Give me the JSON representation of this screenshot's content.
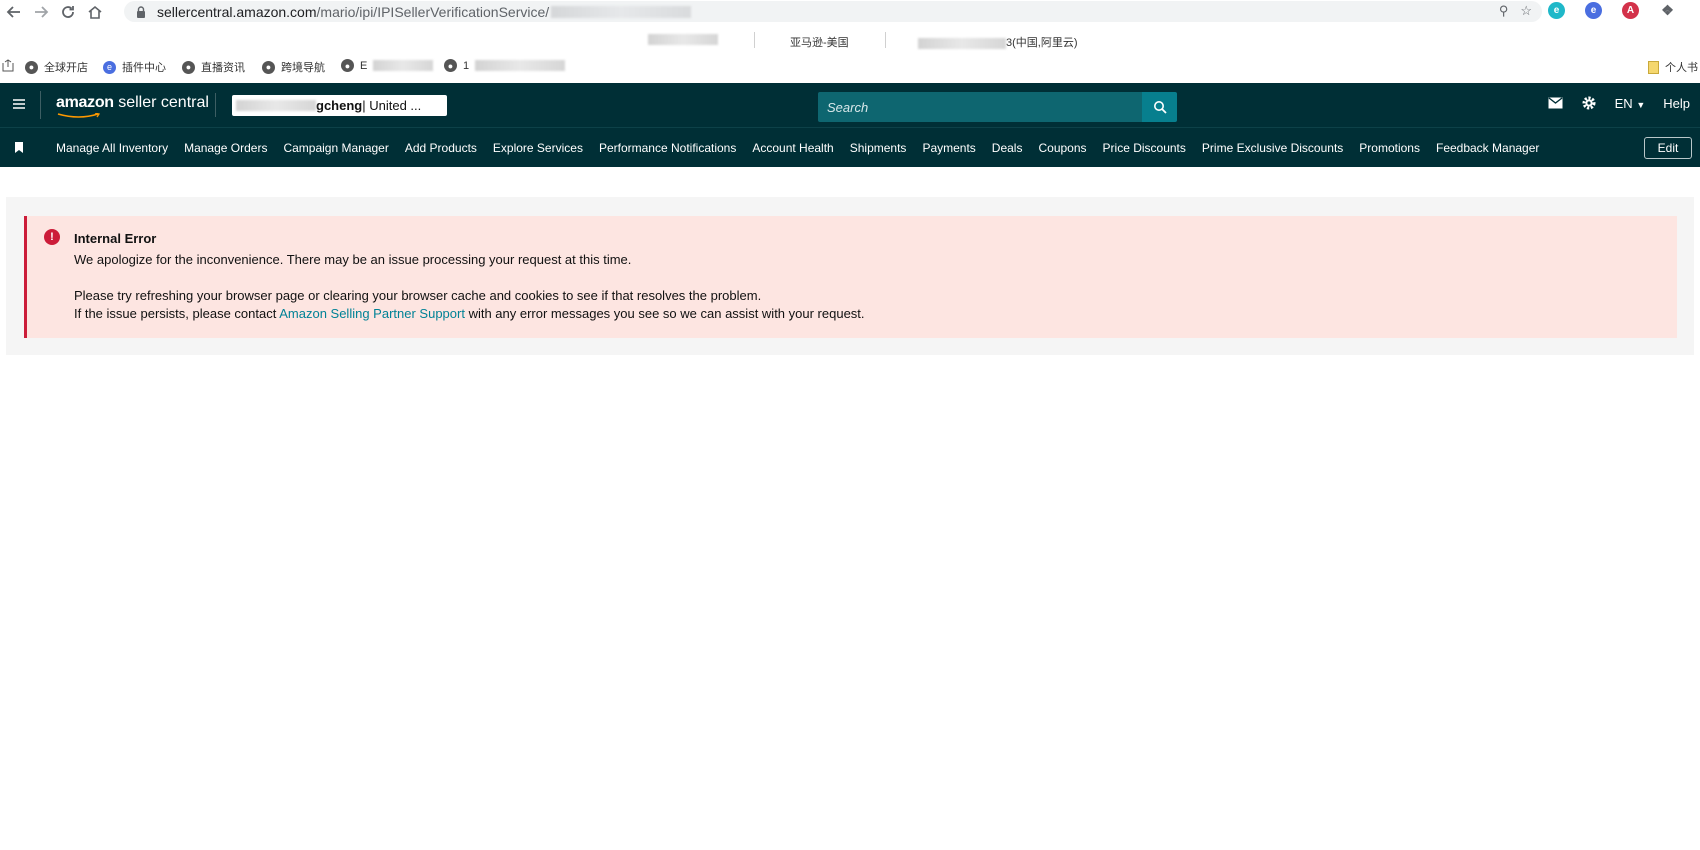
{
  "browser": {
    "url_host": "sellercentral.amazon.com",
    "url_path": "/mario/ipi/IPISellerVerificationService/",
    "tabs": [
      {
        "label": "亚马逊-美国"
      },
      {
        "label": "3(中国,阿里云)"
      }
    ],
    "bookmarks": [
      {
        "label": "全球开店",
        "icon": "globe-icon"
      },
      {
        "label": "插件中心",
        "icon": "plugin-icon"
      },
      {
        "label": "直播资讯",
        "icon": "globe-icon"
      },
      {
        "label": "跨境导航",
        "icon": "globe-icon"
      },
      {
        "label": "E",
        "icon": "globe-icon"
      },
      {
        "label": "1",
        "icon": "globe-icon"
      }
    ],
    "bookmark_folder": "个人书"
  },
  "header": {
    "logo_brand": "amazon",
    "logo_product": " seller central",
    "account_suffix": "gcheng",
    "account_region": " | United ...",
    "search_placeholder": "Search",
    "language": "EN",
    "help": "Help"
  },
  "nav": {
    "items": [
      "Manage All Inventory",
      "Manage Orders",
      "Campaign Manager",
      "Add Products",
      "Explore Services",
      "Performance Notifications",
      "Account Health",
      "Shipments",
      "Payments",
      "Deals",
      "Coupons",
      "Price Discounts",
      "Prime Exclusive Discounts",
      "Promotions",
      "Feedback Manager"
    ],
    "edit": "Edit"
  },
  "alert": {
    "icon": "!",
    "title": "Internal Error",
    "line1": "We apologize for the inconvenience. There may be an issue processing your request at this time.",
    "line2": "Please try refreshing your browser page or clearing your browser cache and cookies to see if that resolves the problem.",
    "line3_pre": "If the issue persists, please contact ",
    "line3_link": "Amazon Selling Partner Support",
    "line3_post": " with any error messages you see so we can assist with your request."
  },
  "colors": {
    "header_bg": "#002f36",
    "search_bg": "#0e6670",
    "alert_bg": "#fde5e1",
    "alert_accent": "#cc1c39",
    "link": "#008296"
  }
}
